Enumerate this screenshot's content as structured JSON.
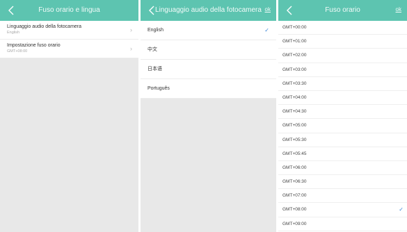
{
  "panel1": {
    "title": "Fuso orario e lingua",
    "items": [
      {
        "label": "Linguaggio audio della fotocamera",
        "value": "English",
        "chevron": "›"
      },
      {
        "label": "Impostazione fuso orario",
        "value": "GMT+08:00",
        "chevron": "›"
      }
    ]
  },
  "panel2": {
    "title": "Linguaggio audio della fotocamera",
    "ok": "ok",
    "options": [
      {
        "label": "English",
        "check": "✓"
      },
      {
        "label": "中文",
        "check": ""
      },
      {
        "label": "日本语",
        "check": ""
      },
      {
        "label": "Português",
        "check": ""
      }
    ]
  },
  "panel3": {
    "title": "Fuso orario",
    "ok": "ok",
    "options": [
      {
        "label": "GMT+00:00",
        "check": ""
      },
      {
        "label": "GMT+01:00",
        "check": ""
      },
      {
        "label": "GMT+02:00",
        "check": ""
      },
      {
        "label": "GMT+03:00",
        "check": ""
      },
      {
        "label": "GMT+03:30",
        "check": ""
      },
      {
        "label": "GMT+04:00",
        "check": ""
      },
      {
        "label": "GMT+04:30",
        "check": ""
      },
      {
        "label": "GMT+05:00",
        "check": ""
      },
      {
        "label": "GMT+05:30",
        "check": ""
      },
      {
        "label": "GMT+05:45",
        "check": ""
      },
      {
        "label": "GMT+06:00",
        "check": ""
      },
      {
        "label": "GMT+06:30",
        "check": ""
      },
      {
        "label": "GMT+07:00",
        "check": ""
      },
      {
        "label": "GMT+08:00",
        "check": "✓"
      },
      {
        "label": "GMT+09:00",
        "check": ""
      }
    ]
  },
  "colors": {
    "header": "#5dc4b0",
    "check": "#3a86d6",
    "background": "#e8e8e8"
  },
  "icons": {
    "back": "back-arrow-icon",
    "chevron": "chevron-right-icon",
    "check": "check-icon"
  }
}
